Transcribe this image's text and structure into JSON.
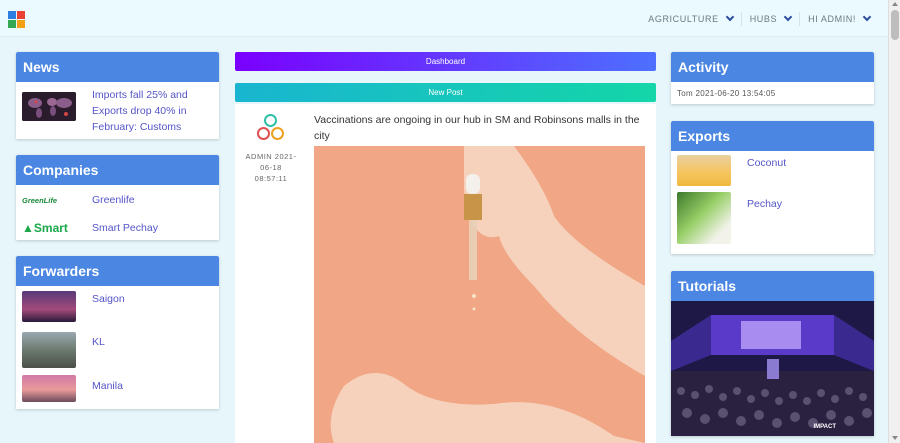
{
  "nav": {
    "items": [
      "AGRICULTURE",
      "HUBS",
      "HI ADMIN!"
    ]
  },
  "news": {
    "title": "News",
    "items": [
      {
        "text": "Imports fall 25% and Exports drop 40% in February: Customs"
      }
    ]
  },
  "companies": {
    "title": "Companies",
    "items": [
      {
        "name": "Greenlife",
        "logo_text": "GreenLife"
      },
      {
        "name": "Smart Pechay",
        "logo_text": "Smart"
      }
    ]
  },
  "forwarders": {
    "title": "Forwarders",
    "items": [
      {
        "name": "Saigon"
      },
      {
        "name": "KL"
      },
      {
        "name": "Manila"
      }
    ]
  },
  "center": {
    "dashboard_label": "Dashboard",
    "newpost_label": "New Post",
    "post": {
      "author": "ADMIN 2021-06-18 08:57:11",
      "text": "Vaccinations are ongoing in our hub in SM and Robinsons malls in the city"
    }
  },
  "activity": {
    "title": "Activity",
    "entry": "Tom 2021-06-20 13:54:05"
  },
  "exports": {
    "title": "Exports",
    "items": [
      {
        "name": "Coconut"
      },
      {
        "name": "Pechay"
      }
    ]
  },
  "tutorials": {
    "title": "Tutorials",
    "image_caption": "IMPACT"
  },
  "colors": {
    "header_blue": "#4a86e2",
    "link": "#5555c8",
    "dashboard_gradient": [
      "#7a00ff",
      "#4d70ff"
    ],
    "newpost_gradient": [
      "#19b5d0",
      "#14d6a8"
    ]
  }
}
